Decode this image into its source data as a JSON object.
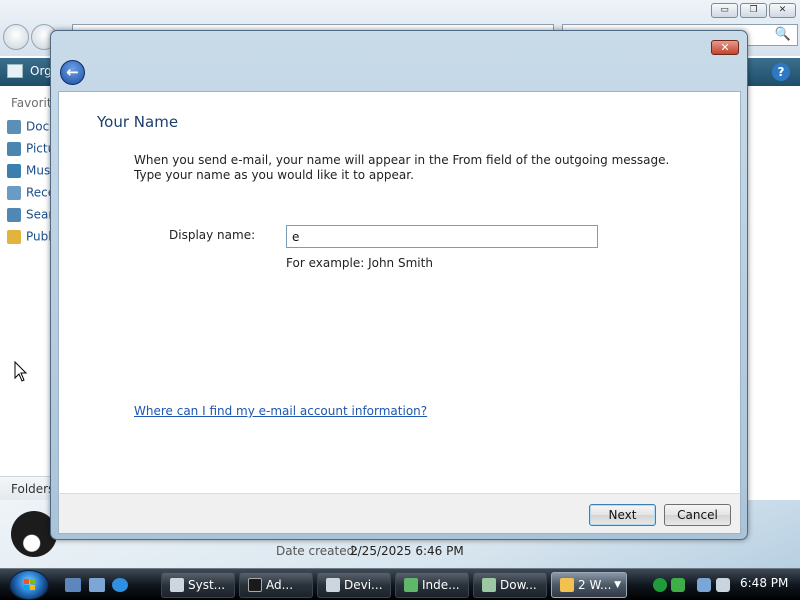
{
  "background_window": {
    "toolbar_label": "Org",
    "favorites_label": "Favorite",
    "nav_items": [
      {
        "label": "Documents",
        "color": "#5a8fb7"
      },
      {
        "label": "Pictures",
        "color": "#4a86b0"
      },
      {
        "label": "Music",
        "color": "#3b7eb0"
      },
      {
        "label": "Recently Changed",
        "color": "#6a9bc4"
      },
      {
        "label": "Searches",
        "color": "#4f87b5"
      },
      {
        "label": "Public",
        "color": "#e3b43d"
      }
    ],
    "folders_label": "Folders",
    "date_created_label": "Date created:",
    "date_created_value": "2/25/2025 6:46 PM",
    "window_controls": {
      "minimize": "▭",
      "maximize": "❐",
      "close": "✕"
    },
    "search_icon": "🔍",
    "help_icon": "?"
  },
  "dialog": {
    "close_symbol": "✕",
    "back_symbol": "←",
    "title": "Your Name",
    "description_line_1": "When you send e-mail, your name will appear in the From field of the outgoing message.",
    "description_line_2": "Type your name as you would like it to appear.",
    "display_name_label": "Display name:",
    "display_name_value": "e",
    "example_text": "For example: John Smith",
    "help_link": "Where can I find my e-mail account information?",
    "next_label": "Next",
    "cancel_label": "Cancel"
  },
  "taskbar": {
    "buttons": [
      {
        "label": "Syst...",
        "active": false
      },
      {
        "label": "Ad...",
        "active": false
      },
      {
        "label": "Devi...",
        "active": false
      },
      {
        "label": "Inde...",
        "active": false
      },
      {
        "label": "Dow...",
        "active": false
      },
      {
        "label": "2 W...",
        "active": true
      }
    ],
    "clock": "6:48 PM"
  }
}
